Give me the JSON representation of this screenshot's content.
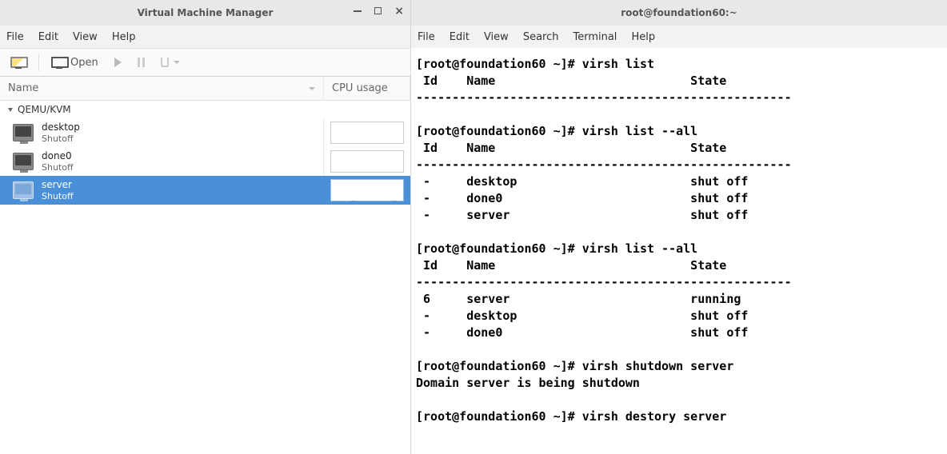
{
  "vmm": {
    "title": "Virtual Machine Manager",
    "menu": {
      "file": "File",
      "edit": "Edit",
      "view": "View",
      "help": "Help"
    },
    "toolbar": {
      "open": "Open"
    },
    "columns": {
      "name": "Name",
      "cpu": "CPU usage"
    },
    "group": "QEMU/KVM",
    "vms": [
      {
        "name": "desktop",
        "state": "Shutoff",
        "selected": false,
        "graph": false
      },
      {
        "name": "done0",
        "state": "Shutoff",
        "selected": false,
        "graph": false
      },
      {
        "name": "server",
        "state": "Shutoff",
        "selected": true,
        "graph": true
      }
    ]
  },
  "term": {
    "title": "root@foundation60:~",
    "menu": {
      "file": "File",
      "edit": "Edit",
      "view": "View",
      "search": "Search",
      "terminal": "Terminal",
      "help": "Help"
    },
    "content": "[root@foundation60 ~]# virsh list\n Id    Name                           State\n----------------------------------------------------\n\n[root@foundation60 ~]# virsh list --all\n Id    Name                           State\n----------------------------------------------------\n -     desktop                        shut off\n -     done0                          shut off\n -     server                         shut off\n\n[root@foundation60 ~]# virsh list --all\n Id    Name                           State\n----------------------------------------------------\n 6     server                         running\n -     desktop                        shut off\n -     done0                          shut off\n\n[root@foundation60 ~]# virsh shutdown server\nDomain server is being shutdown\n\n[root@foundation60 ~]# virsh destory server"
  }
}
